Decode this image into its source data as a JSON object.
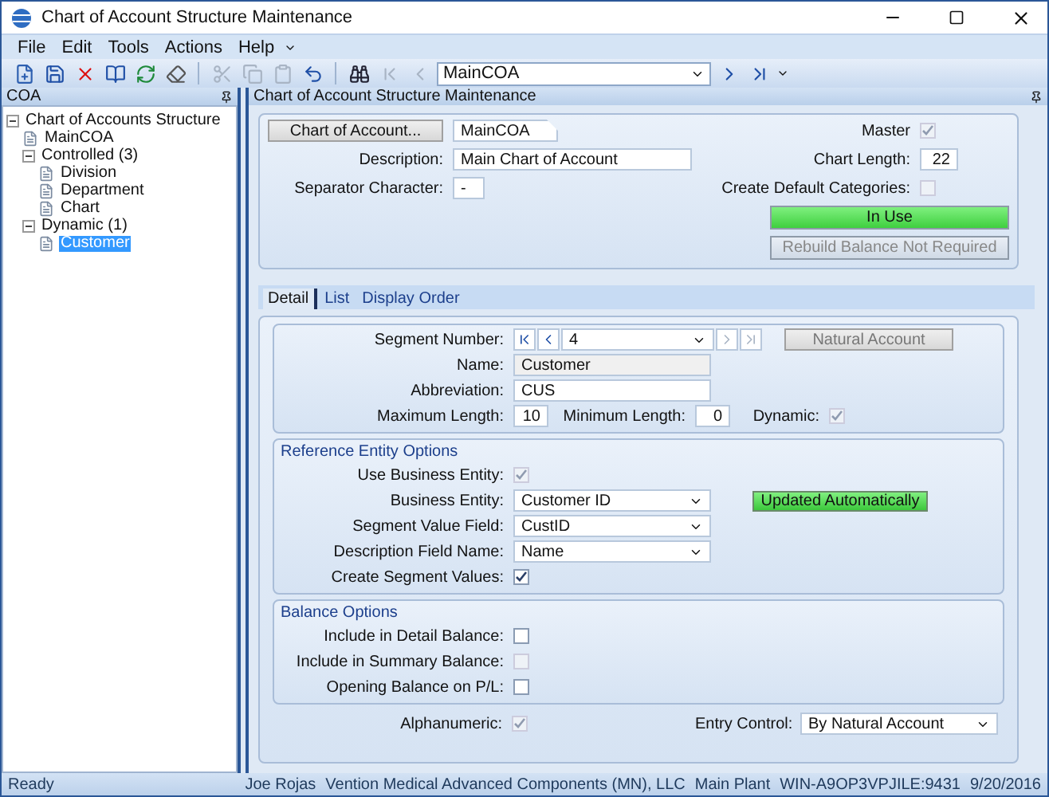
{
  "window": {
    "title": "Chart of Account Structure Maintenance"
  },
  "menu": [
    {
      "label": "File"
    },
    {
      "label": "Edit"
    },
    {
      "label": "Tools"
    },
    {
      "label": "Actions"
    },
    {
      "label": "Help"
    }
  ],
  "toolbar": [
    {
      "kind": "new",
      "disabled": false
    },
    {
      "kind": "save",
      "disabled": false
    },
    {
      "kind": "delete",
      "disabled": false
    },
    {
      "kind": "book",
      "disabled": false
    },
    {
      "kind": "refresh",
      "disabled": false
    },
    {
      "kind": "eraser",
      "disabled": false
    },
    {
      "kind": "sep"
    },
    {
      "kind": "cut",
      "disabled": true
    },
    {
      "kind": "copy",
      "disabled": true
    },
    {
      "kind": "paste",
      "disabled": true
    },
    {
      "kind": "undo",
      "disabled": false
    },
    {
      "kind": "sep"
    },
    {
      "kind": "find",
      "disabled": false
    },
    {
      "kind": "first",
      "disabled": true
    },
    {
      "kind": "prev",
      "disabled": true
    },
    {
      "kind": "field",
      "value": "MainCOA"
    },
    {
      "kind": "next",
      "disabled": false
    },
    {
      "kind": "last",
      "disabled": false
    }
  ],
  "tree_panel": {
    "title": "COA",
    "items": [
      {
        "label": "Chart of Accounts Structure",
        "selected": false,
        "expanded": true,
        "children": [
          {
            "label": "MainCOA",
            "selected": false
          },
          {
            "label": "Controlled (3)",
            "selected": false,
            "expanded": true,
            "children": [
              {
                "label": "Division",
                "selected": false
              },
              {
                "label": "Department",
                "selected": false
              },
              {
                "label": "Chart",
                "selected": false
              }
            ]
          },
          {
            "label": "Dynamic (1)",
            "selected": false,
            "expanded": true,
            "children": [
              {
                "label": "Customer",
                "selected": true
              }
            ]
          }
        ]
      }
    ]
  },
  "main": {
    "title": "Chart of Account Structure Maintenance",
    "chart": {
      "button": "Chart of Account...",
      "value": "MainCOA"
    },
    "description": {
      "label": "Description:",
      "value": "Main Chart of Account"
    },
    "separator": {
      "label": "Separator Character:",
      "value": "-"
    },
    "master": {
      "label": "Master",
      "checked": true,
      "disabled": true
    },
    "chart_length": {
      "label": "Chart Length:",
      "value": "22"
    },
    "create_default": {
      "label": "Create Default Categories:",
      "checked": false,
      "disabled": true
    },
    "status_buttons": [
      {
        "label": "In Use",
        "kind": "status",
        "disabled": false
      },
      {
        "label": "Rebuild Balance Not Required",
        "kind": "action",
        "disabled": true
      }
    ],
    "tabs": [
      {
        "label": "Detail",
        "selected": true
      },
      {
        "label": "List",
        "selected": false
      },
      {
        "label": "Display Order",
        "selected": false
      }
    ],
    "segment": {
      "label": "Segment Number:",
      "value": "4",
      "button": {
        "label": "Natural Account",
        "disabled": true
      }
    },
    "fields": [
      {
        "label": "Name:",
        "value": "Customer",
        "disabled": true
      },
      {
        "label": "Abbreviation:",
        "value": "CUS",
        "disabled": false
      }
    ],
    "lengths": [
      {
        "kind": "number",
        "label": "Maximum Length:",
        "value": "10"
      },
      {
        "kind": "number",
        "label": "Minimum Length:",
        "value": "0"
      },
      {
        "kind": "checkbox",
        "label": "Dynamic:",
        "checked": true,
        "disabled": true
      }
    ],
    "reference": {
      "title": "Reference Entity Options",
      "rows": [
        {
          "kind": "checkbox",
          "label": "Use Business Entity:",
          "checked": true,
          "disabled": true
        },
        {
          "kind": "select",
          "label": "Business Entity:",
          "value": "Customer ID",
          "badge": "Updated Automatically"
        },
        {
          "kind": "select",
          "label": "Segment Value Field:",
          "value": "CustID"
        },
        {
          "kind": "select",
          "label": "Description Field Name:",
          "value": "Name"
        },
        {
          "kind": "checkbox",
          "label": "Create Segment Values:",
          "checked": true,
          "disabled": false
        }
      ]
    },
    "balance": {
      "title": "Balance Options",
      "rows": [
        {
          "kind": "checkbox",
          "label": "Include in Detail Balance:",
          "checked": false,
          "disabled": false
        },
        {
          "kind": "checkbox",
          "label": "Include in Summary Balance:",
          "checked": false,
          "disabled": true
        },
        {
          "kind": "checkbox",
          "label": "Opening Balance on P/L:",
          "checked": false,
          "disabled": false
        }
      ]
    },
    "footer": [
      {
        "kind": "checkbox",
        "label": "Alphanumeric:",
        "checked": true,
        "disabled": true
      },
      {
        "kind": "select",
        "label": "Entry Control:",
        "value": "By Natural Account"
      }
    ]
  },
  "status_bar": {
    "left": "Ready",
    "right": [
      "Joe Rojas",
      "Vention Medical Advanced Components (MN), LLC",
      "Main Plant",
      "WIN-A9OP3VPJILE:9431",
      "9/20/2016"
    ]
  }
}
